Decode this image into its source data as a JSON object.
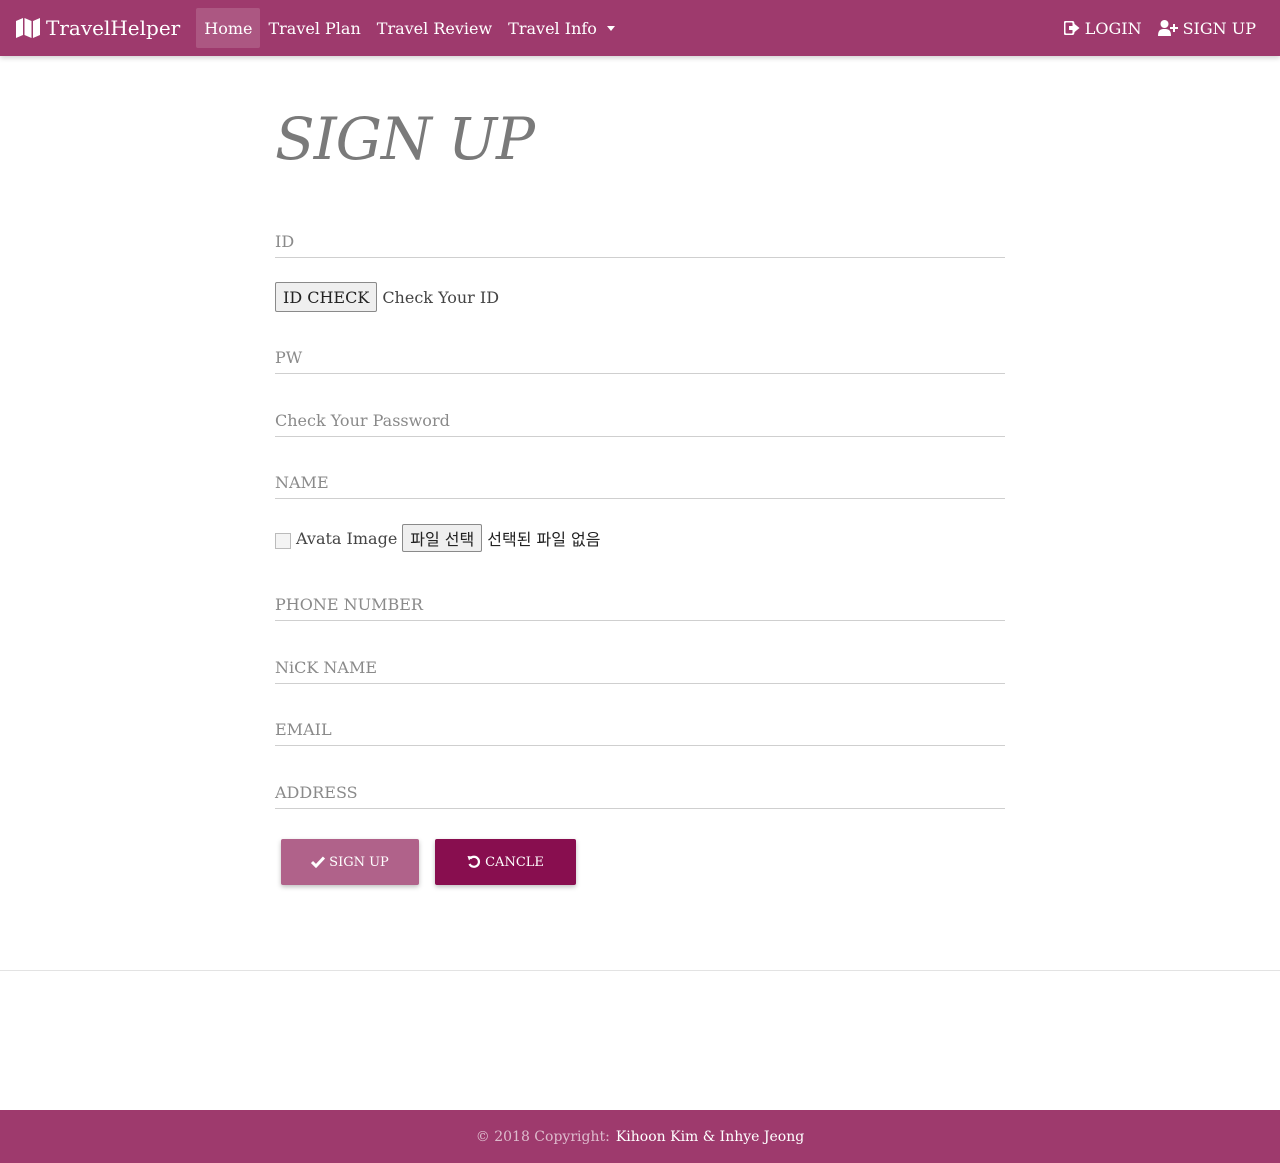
{
  "navbar": {
    "brand": "TravelHelper",
    "brand_icon": "map-icon",
    "links": [
      {
        "label": "Home"
      },
      {
        "label": "Travel Plan"
      },
      {
        "label": "Travel Review"
      },
      {
        "label": "Travel Info"
      }
    ],
    "login_label": "LOGIN",
    "signup_label": "SIGN UP",
    "color": "#9e3a6d"
  },
  "form": {
    "title": "SIGN UP",
    "id_placeholder": "ID",
    "id_check_button": "ID CHECK",
    "id_check_text": "Check Your ID",
    "pw_placeholder": "PW",
    "pw_check_placeholder": "Check Your Password",
    "name_placeholder": "NAME",
    "avatar_alt": "Avata Image",
    "file_button": "파일 선택",
    "file_status": "선택된 파일 없음",
    "phone_placeholder": "PHONE NUMBER",
    "nickname_placeholder": "NiCK NAME",
    "email_placeholder": "EMAIL",
    "address_placeholder": "ADDRESS",
    "submit_label": "SIGN UP",
    "cancel_label": "CANCLE",
    "submit_color": "#b0628a",
    "cancel_color": "#880e4f"
  },
  "footer": {
    "copyright": "© 2018 Copyright:",
    "authors": "Kihoon Kim & Inhye Jeong"
  }
}
